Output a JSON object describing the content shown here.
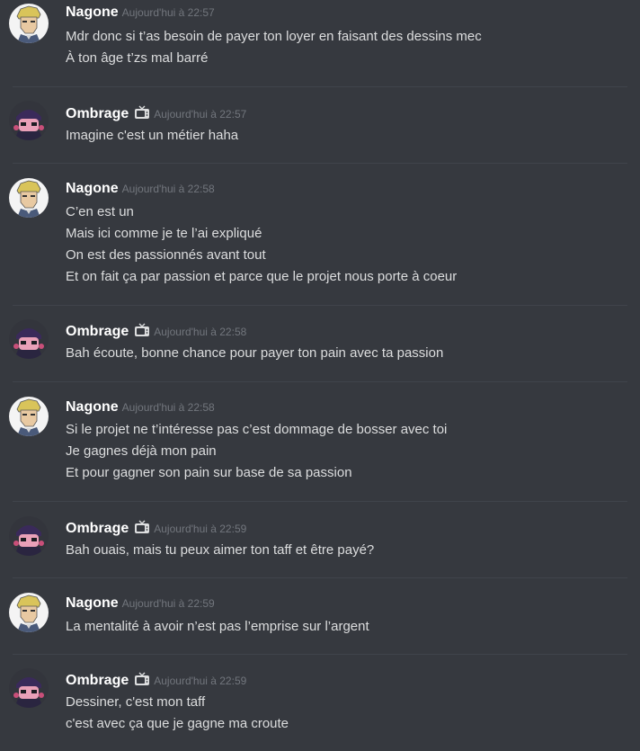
{
  "messages": [
    {
      "author": "Nagone",
      "avatar": "nagone-avatar",
      "badge": null,
      "time": "Aujourd'hui à 22:57",
      "lines": [
        "Mdr donc si t’as besoin de payer ton loyer en faisant des dessins mec",
        "À ton âge t’zs mal barré"
      ]
    },
    {
      "author": "Ombrage",
      "avatar": "ombrage-avatar",
      "badge": "tv-icon",
      "time": "Aujourd'hui à 22:57",
      "lines": [
        "Imagine c'est un métier haha"
      ]
    },
    {
      "author": "Nagone",
      "avatar": "nagone-avatar",
      "badge": null,
      "time": "Aujourd'hui à 22:58",
      "lines": [
        "C’en est un",
        "Mais ici comme je te l’ai expliqué",
        "On est des passionnés avant tout",
        "Et on fait ça par passion et parce que le projet nous porte à coeur"
      ]
    },
    {
      "author": "Ombrage",
      "avatar": "ombrage-avatar",
      "badge": "tv-icon",
      "time": "Aujourd'hui à 22:58",
      "lines": [
        "Bah écoute, bonne chance pour payer ton pain avec ta passion"
      ]
    },
    {
      "author": "Nagone",
      "avatar": "nagone-avatar",
      "badge": null,
      "time": "Aujourd'hui à 22:58",
      "lines": [
        "Si le projet ne t’intéresse pas c’est dommage de bosser avec toi",
        "Je gagnes déjà mon pain",
        "Et pour gagner son pain sur base de sa passion"
      ]
    },
    {
      "author": "Ombrage",
      "avatar": "ombrage-avatar",
      "badge": "tv-icon",
      "time": "Aujourd'hui à 22:59",
      "lines": [
        "Bah ouais, mais tu peux aimer ton taff et être payé?"
      ]
    },
    {
      "author": "Nagone",
      "avatar": "nagone-avatar",
      "badge": null,
      "time": "Aujourd'hui à 22:59",
      "lines": [
        "La mentalité à avoir n’est pas l’emprise sur l’argent"
      ]
    },
    {
      "author": "Ombrage",
      "avatar": "ombrage-avatar",
      "badge": "tv-icon",
      "time": "Aujourd'hui à 22:59",
      "lines": [
        "Dessiner, c'est mon taff",
        "c'est avec ça que je gagne ma croute"
      ]
    }
  ],
  "colors": {
    "background": "#36393f",
    "author": "#ffffff",
    "timestamp": "#72767d",
    "text": "#dcddde",
    "divider": "#40444b"
  }
}
